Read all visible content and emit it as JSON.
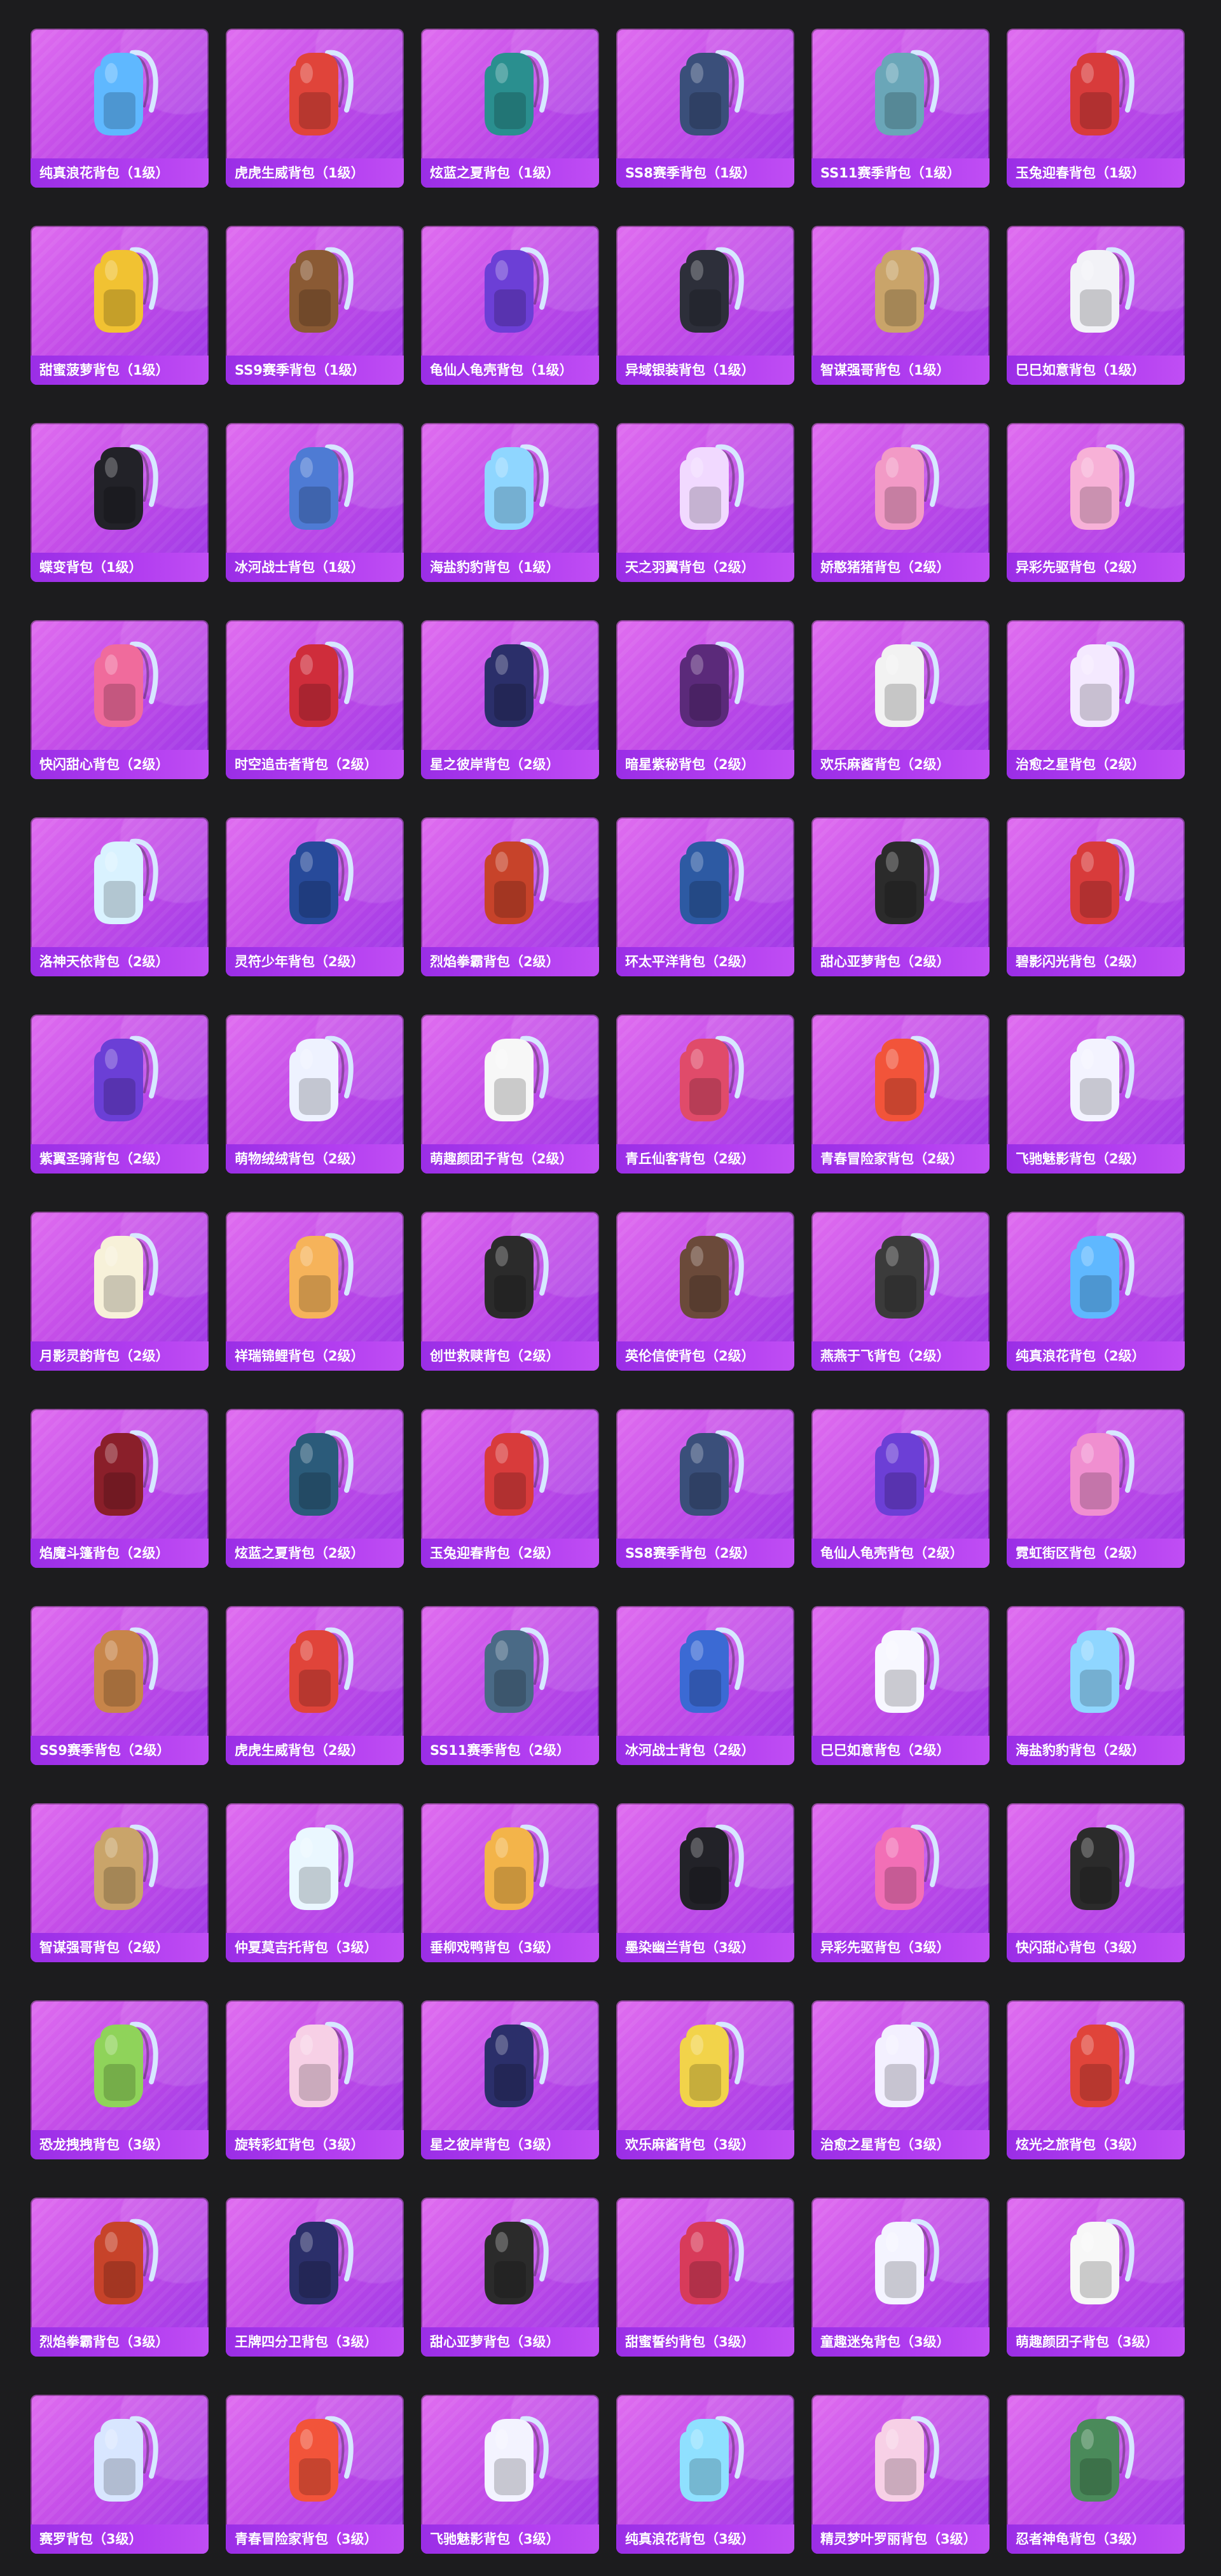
{
  "colors": {
    "page_background": "#1c1c1e",
    "card_gradient_start": "#e06ef0",
    "card_gradient_end": "#9a37e6",
    "label_bar": "#a834ec",
    "label_text": "#ffffff"
  },
  "items": [
    {
      "label": "纯真浪花背包（1级）",
      "icon": "cup-backpack-icon",
      "color": "#5fb8ff"
    },
    {
      "label": "虎虎生威背包（1级）",
      "icon": "tiger-backpack-icon",
      "color": "#e0443a"
    },
    {
      "label": "炫蓝之夏背包（1级）",
      "icon": "backpack-icon",
      "color": "#2a8f8f"
    },
    {
      "label": "SS8赛季背包（1级）",
      "icon": "backpack-icon",
      "color": "#3a4f7a"
    },
    {
      "label": "SS11赛季背包（1级）",
      "icon": "backpack-icon",
      "color": "#6aa6b8"
    },
    {
      "label": "玉兔迎春背包（1级）",
      "icon": "backpack-icon",
      "color": "#d83b3b"
    },
    {
      "label": "甜蜜菠萝背包（1级）",
      "icon": "pineapple-backpack-icon",
      "color": "#f1c232"
    },
    {
      "label": "SS9赛季背包（1级）",
      "icon": "backpack-icon",
      "color": "#8a5a34"
    },
    {
      "label": "龟仙人龟壳背包（1级）",
      "icon": "backpack-icon",
      "color": "#6c3fd6"
    },
    {
      "label": "异域银装背包（1级）",
      "icon": "backpack-icon",
      "color": "#2d2f3a"
    },
    {
      "label": "智谋强哥背包（1级）",
      "icon": "backpack-icon",
      "color": "#c9a46a"
    },
    {
      "label": "巳巳如意背包（1级）",
      "icon": "backpack-icon",
      "color": "#f2f2f7"
    },
    {
      "label": "蝶变背包（1级）",
      "icon": "backpack-icon",
      "color": "#222228"
    },
    {
      "label": "冰河战士背包（1级）",
      "icon": "backpack-icon",
      "color": "#4e7bd4"
    },
    {
      "label": "海盐豹豹背包（1级）",
      "icon": "backpack-icon",
      "color": "#8fd6ff"
    },
    {
      "label": "天之羽翼背包（2级）",
      "icon": "backpack-icon",
      "color": "#f1d9ff"
    },
    {
      "label": "娇憨猪猪背包（2级）",
      "icon": "backpack-icon",
      "color": "#f29ac6"
    },
    {
      "label": "异彩先驱背包（2级）",
      "icon": "backpack-icon",
      "color": "#f7b1d7"
    },
    {
      "label": "快闪甜心背包（2级）",
      "icon": "backpack-icon",
      "color": "#f06b9c"
    },
    {
      "label": "时空追击者背包（2级）",
      "icon": "backpack-icon",
      "color": "#cf2d3b"
    },
    {
      "label": "星之彼岸背包（2级）",
      "icon": "backpack-icon",
      "color": "#2b2f6a"
    },
    {
      "label": "暗星紫秘背包（2级）",
      "icon": "backpack-icon",
      "color": "#5b2a7a"
    },
    {
      "label": "欢乐麻酱背包（2级）",
      "icon": "backpack-icon",
      "color": "#f2f2f2"
    },
    {
      "label": "治愈之星背包（2级）",
      "icon": "backpack-icon",
      "color": "#f4e9ff"
    },
    {
      "label": "洛神天依背包（2级）",
      "icon": "backpack-icon",
      "color": "#d9f2ff"
    },
    {
      "label": "灵符少年背包（2级）",
      "icon": "backpack-icon",
      "color": "#274a9a"
    },
    {
      "label": "烈焰拳霸背包（2级）",
      "icon": "backpack-icon",
      "color": "#c7432a"
    },
    {
      "label": "环太平洋背包（2级）",
      "icon": "backpack-icon",
      "color": "#2d5aa3"
    },
    {
      "label": "甜心亚萝背包（2级）",
      "icon": "backpack-icon",
      "color": "#2b2b2b"
    },
    {
      "label": "碧影闪光背包（2级）",
      "icon": "backpack-icon",
      "color": "#d83b3b"
    },
    {
      "label": "紫翼圣骑背包（2级）",
      "icon": "backpack-icon",
      "color": "#6b3fd6"
    },
    {
      "label": "萌物绒绒背包（2级）",
      "icon": "backpack-icon",
      "color": "#eef2ff"
    },
    {
      "label": "萌趣颜团子背包（2级）",
      "icon": "backpack-icon",
      "color": "#f7f7f7"
    },
    {
      "label": "青丘仙客背包（2级）",
      "icon": "backpack-icon",
      "color": "#e04b6a"
    },
    {
      "label": "青春冒险家背包（2级）",
      "icon": "backpack-icon",
      "color": "#f2543a"
    },
    {
      "label": "飞驰魅影背包（2级）",
      "icon": "backpack-icon",
      "color": "#f3f3ff"
    },
    {
      "label": "月影灵韵背包（2级）",
      "icon": "backpack-icon",
      "color": "#f7f1d9"
    },
    {
      "label": "祥瑞锦鲤背包（2级）",
      "icon": "backpack-icon",
      "color": "#f6b35a"
    },
    {
      "label": "创世救赎背包（2级）",
      "icon": "backpack-icon",
      "color": "#2b2b2b"
    },
    {
      "label": "英伦信使背包（2级）",
      "icon": "backpack-icon",
      "color": "#6b4a3a"
    },
    {
      "label": "燕燕于飞背包（2级）",
      "icon": "backpack-icon",
      "color": "#3b3b3b"
    },
    {
      "label": "纯真浪花背包（2级）",
      "icon": "cup-backpack-icon",
      "color": "#5fb8ff"
    },
    {
      "label": "焰魔斗篷背包（2级）",
      "icon": "backpack-icon",
      "color": "#8a1f2a"
    },
    {
      "label": "炫蓝之夏背包（2级）",
      "icon": "backpack-icon",
      "color": "#2b5b7a"
    },
    {
      "label": "玉兔迎春背包（2级）",
      "icon": "backpack-icon",
      "color": "#d83b3b"
    },
    {
      "label": "SS8赛季背包（2级）",
      "icon": "backpack-icon",
      "color": "#3a4f7a"
    },
    {
      "label": "龟仙人龟壳背包（2级）",
      "icon": "backpack-icon",
      "color": "#6c3fd6"
    },
    {
      "label": "霓虹街区背包（2级）",
      "icon": "backpack-icon",
      "color": "#f08fd0"
    },
    {
      "label": "SS9赛季背包（2级）",
      "icon": "backpack-icon",
      "color": "#c7854a"
    },
    {
      "label": "虎虎生威背包（2级）",
      "icon": "backpack-icon",
      "color": "#e0443a"
    },
    {
      "label": "SS11赛季背包（2级）",
      "icon": "backpack-icon",
      "color": "#4a6a86"
    },
    {
      "label": "冰河战士背包（2级）",
      "icon": "backpack-icon",
      "color": "#3b6ad4"
    },
    {
      "label": "巳巳如意背包（2级）",
      "icon": "backpack-icon",
      "color": "#f7f7ff"
    },
    {
      "label": "海盐豹豹背包（2级）",
      "icon": "backpack-icon",
      "color": "#8fd6ff"
    },
    {
      "label": "智谋强哥背包（2级）",
      "icon": "backpack-icon",
      "color": "#c9a46a"
    },
    {
      "label": "仲夏莫吉托背包（3级）",
      "icon": "backpack-icon",
      "color": "#eaf7ff"
    },
    {
      "label": "垂柳戏鸭背包（3级）",
      "icon": "backpack-icon",
      "color": "#f3b44a"
    },
    {
      "label": "墨染幽兰背包（3级）",
      "icon": "backpack-icon",
      "color": "#222228"
    },
    {
      "label": "异彩先驱背包（3级）",
      "icon": "backpack-icon",
      "color": "#f26fb6"
    },
    {
      "label": "快闪甜心背包（3级）",
      "icon": "backpack-icon",
      "color": "#2b2b2b"
    },
    {
      "label": "恐龙拽拽背包（3级）",
      "icon": "backpack-icon",
      "color": "#8fd35a"
    },
    {
      "label": "旋转彩虹背包（3级）",
      "icon": "backpack-icon",
      "color": "#f7d0e6"
    },
    {
      "label": "星之彼岸背包（3级）",
      "icon": "backpack-icon",
      "color": "#2b2f6a"
    },
    {
      "label": "欢乐麻酱背包（3级）",
      "icon": "backpack-icon",
      "color": "#f2d34a"
    },
    {
      "label": "治愈之星背包（3级）",
      "icon": "backpack-icon",
      "color": "#f3f0ff"
    },
    {
      "label": "炫光之旅背包（3级）",
      "icon": "backpack-icon",
      "color": "#e0443a"
    },
    {
      "label": "烈焰拳霸背包（3级）",
      "icon": "backpack-icon",
      "color": "#c7432a"
    },
    {
      "label": "王牌四分卫背包（3级）",
      "icon": "backpack-icon",
      "color": "#2b2f6a"
    },
    {
      "label": "甜心亚萝背包（3级）",
      "icon": "backpack-icon",
      "color": "#2b2b2b"
    },
    {
      "label": "甜蜜誓约背包（3级）",
      "icon": "backpack-icon",
      "color": "#d83b5a"
    },
    {
      "label": "童趣迷兔背包（3级）",
      "icon": "backpack-icon",
      "color": "#f4f4ff"
    },
    {
      "label": "萌趣颜团子背包（3级）",
      "icon": "backpack-icon",
      "color": "#f7f7f7"
    },
    {
      "label": "赛罗背包（3级）",
      "icon": "backpack-icon",
      "color": "#d8e6ff"
    },
    {
      "label": "青春冒险家背包（3级）",
      "icon": "backpack-icon",
      "color": "#f2543a"
    },
    {
      "label": "飞驰魅影背包（3级）",
      "icon": "backpack-icon",
      "color": "#f3f3ff"
    },
    {
      "label": "纯真浪花背包（3级）",
      "icon": "cup-backpack-icon",
      "color": "#8fe0ff"
    },
    {
      "label": "精灵梦叶罗丽背包（3级）",
      "icon": "backpack-icon",
      "color": "#f7d0e6"
    },
    {
      "label": "忍者神龟背包（3级）",
      "icon": "backpack-icon",
      "color": "#4a8a5a"
    }
  ]
}
